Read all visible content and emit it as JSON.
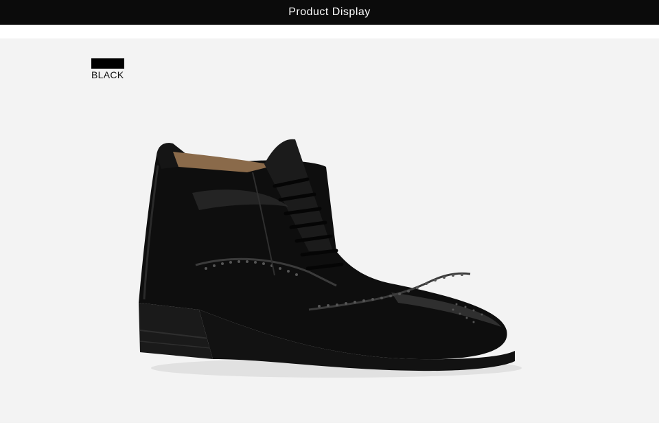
{
  "header": {
    "title": "Product Display"
  },
  "product": {
    "color_label": "BLACK",
    "swatch_color": "#000000",
    "image_subject": "black leather lace-up brogue ankle boot"
  },
  "colors": {
    "header_bg": "#0b0b0b",
    "panel_bg": "#f3f3f3"
  }
}
